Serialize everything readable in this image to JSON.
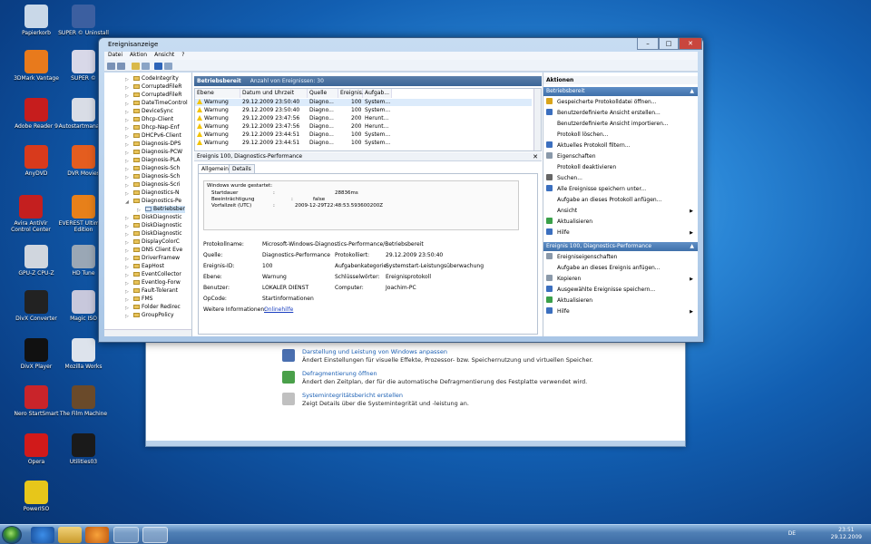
{
  "desktop": {
    "icons": [
      {
        "label": "Papierkorb",
        "color": "#c9d8e8"
      },
      {
        "label": "SUPER © Uninstall",
        "color": "#3c5fa0"
      },
      {
        "label": "3DMark Vantage",
        "color": "#e87a1c"
      },
      {
        "label": "SUPER ©",
        "color": "#d8d8e8"
      },
      {
        "label": "Adobe Reader 9",
        "color": "#c61d1d"
      },
      {
        "label": "Autostartmanager",
        "color": "#d9dde6"
      },
      {
        "label": "AnyDVD",
        "color": "#d83a1c"
      },
      {
        "label": "DVR Movies",
        "color": "#e45d1f"
      },
      {
        "label": "Avira AntiVir Control Center",
        "color": "#c41f1f"
      },
      {
        "label": "EVEREST Ultimate Edition",
        "color": "#e7801a"
      },
      {
        "label": "GPU-Z CPU-Z",
        "color": "#d0d6de"
      },
      {
        "label": "HD Tune",
        "color": "#9aa7b5"
      },
      {
        "label": "DivX Converter",
        "color": "#222"
      },
      {
        "label": "Magic ISO",
        "color": "#c8c8dc"
      },
      {
        "label": "DivX Player",
        "color": "#111"
      },
      {
        "label": "Mozilla Works",
        "color": "#dde3ec"
      },
      {
        "label": "Nero StartSmart",
        "color": "#c9242a"
      },
      {
        "label": "The Film Machine",
        "color": "#6a4a2a"
      },
      {
        "label": "Opera",
        "color": "#d11a1a"
      },
      {
        "label": "Utilities03",
        "color": "#1a1a1a"
      },
      {
        "label": "PowerISO",
        "color": "#e7c61a"
      }
    ]
  },
  "background_window": {
    "items": [
      {
        "link": "Darstellung und Leistung von Windows anpassen",
        "desc": "Ändert Einstellungen für visuelle Effekte, Prozessor- bzw. Speichernutzung und virtuellen Speicher.",
        "color": "#4a6fb0"
      },
      {
        "link": "Defragmentierung öffnen",
        "desc": "Ändert den Zeitplan, der für die automatische Defragmentierung des Festplatte verwendet wird.",
        "color": "#4aa04a"
      },
      {
        "link": "Systemintegritätsbericht erstellen",
        "desc": "Zeigt Details über die Systemintegrität und -leistung an.",
        "color": "#c0c0c0"
      }
    ]
  },
  "window": {
    "title": "Ereignisanzeige",
    "controls": {
      "min": "–",
      "max": "□",
      "close": "✕"
    },
    "menu": [
      "Datei",
      "Aktion",
      "Ansicht",
      "?"
    ],
    "tree": [
      {
        "label": "CodeIntegrity"
      },
      {
        "label": "CorruptedFileR"
      },
      {
        "label": "CorruptedFileR"
      },
      {
        "label": "DateTimeControl"
      },
      {
        "label": "DeviceSync"
      },
      {
        "label": "Dhcp-Client"
      },
      {
        "label": "Dhcp-Nap-Enf"
      },
      {
        "label": "DHCPv6-Client"
      },
      {
        "label": "Diagnosis-DPS"
      },
      {
        "label": "Diagnosis-PCW"
      },
      {
        "label": "Diagnosis-PLA"
      },
      {
        "label": "Diagnosis-Sch"
      },
      {
        "label": "Diagnosis-Sch"
      },
      {
        "label": "Diagnosis-Scri"
      },
      {
        "label": "Diagnostics-N"
      },
      {
        "label": "Diagnostics-Pe"
      },
      {
        "label": "Betriebsber"
      },
      {
        "label": "DiskDiagnostic"
      },
      {
        "label": "DiskDiagnostic"
      },
      {
        "label": "DiskDiagnostic"
      },
      {
        "label": "DisplayColorC"
      },
      {
        "label": "DNS Client Eve"
      },
      {
        "label": "DriverFramew"
      },
      {
        "label": "EapHost"
      },
      {
        "label": "EventCollector"
      },
      {
        "label": "Eventlog-Forw"
      },
      {
        "label": "Fault-Tolerant"
      },
      {
        "label": "FMS"
      },
      {
        "label": "Folder Redirec"
      },
      {
        "label": "GroupPolicy"
      }
    ],
    "center": {
      "title": "Betriebsbereit",
      "count": "Anzahl von Ereignissen: 30",
      "columns": [
        "Ebene",
        "Datum und Uhrzeit",
        "Quelle",
        "Ereignis...",
        "Aufgab..."
      ],
      "rows": [
        {
          "level": "Warnung",
          "date": "29.12.2009 23:50:40",
          "source": "Diagno...",
          "id": "100",
          "task": "System..."
        },
        {
          "level": "Warnung",
          "date": "29.12.2009 23:50:40",
          "source": "Diagno...",
          "id": "100",
          "task": "System..."
        },
        {
          "level": "Warnung",
          "date": "29.12.2009 23:47:56",
          "source": "Diagno...",
          "id": "200",
          "task": "Herunt..."
        },
        {
          "level": "Warnung",
          "date": "29.12.2009 23:47:56",
          "source": "Diagno...",
          "id": "200",
          "task": "Herunt..."
        },
        {
          "level": "Warnung",
          "date": "29.12.2009 23:44:51",
          "source": "Diagno...",
          "id": "100",
          "task": "System..."
        },
        {
          "level": "Warnung",
          "date": "29.12.2009 23:44:51",
          "source": "Diagno...",
          "id": "100",
          "task": "System..."
        }
      ],
      "detail_title": "Ereignis 100, Diagnostics-Performance",
      "tabs": [
        "Allgemein",
        "Details"
      ],
      "xml": {
        "heading": "Windows wurde gestartet:",
        "lines": [
          {
            "k": "Startdauer",
            "sep": ":",
            "v": "28836ms"
          },
          {
            "k": "Beeinträchtigung",
            "sep": ":",
            "v": "false"
          },
          {
            "k": "Vorfallzeit (UTC)",
            "sep": ":",
            "v": "2009-12-29T22:48:53.593600200Z"
          }
        ]
      },
      "props": {
        "protokollname_label": "Protokollname:",
        "protokollname": "Microsoft-Windows-Diagnostics-Performance/Betriebsbereit",
        "quelle_label": "Quelle:",
        "quelle": "Diagnostics-Performance",
        "protokolliert_label": "Protokolliert:",
        "protokolliert": "29.12.2009 23:50:40",
        "ereignisid_label": "Ereignis-ID:",
        "ereignisid": "100",
        "aufgabe_label": "Aufgabenkategorie:",
        "aufgabe": "Systemstart-Leistungsüberwachung",
        "ebene_label": "Ebene:",
        "ebene": "Warnung",
        "schluessel_label": "Schlüsselwörter:",
        "schluessel": "Ereignisprotokoll",
        "benutzer_label": "Benutzer:",
        "benutzer": "LOKALER DIENST",
        "computer_label": "Computer:",
        "computer": "Joachim-PC",
        "opcode_label": "OpCode:",
        "opcode": "Startinformationen",
        "info_label": "Weitere Informationen:",
        "info_link": "Onlinehilfe"
      }
    },
    "actions": {
      "header": "Aktionen",
      "section1": "Betriebsbereit",
      "items1": [
        {
          "label": "Gespeicherte Protokolldatei öffnen...",
          "color": "#d9a41a",
          "sub": ""
        },
        {
          "label": "Benutzerdefinierte Ansicht erstellen...",
          "color": "#3b6fbf",
          "sub": ""
        },
        {
          "label": "Benutzerdefinierte Ansicht importieren...",
          "color": "#ffffff",
          "sub": ""
        },
        {
          "label": "Protokoll löschen...",
          "color": "#ffffff",
          "sub": ""
        },
        {
          "label": "Aktuelles Protokoll filtern...",
          "color": "#3b6fbf",
          "sub": ""
        },
        {
          "label": "Eigenschaften",
          "color": "#8a99aa",
          "sub": ""
        },
        {
          "label": "Protokoll deaktivieren",
          "color": "#ffffff",
          "sub": ""
        },
        {
          "label": "Suchen...",
          "color": "#666666",
          "sub": ""
        },
        {
          "label": "Alle Ereignisse speichern unter...",
          "color": "#3b6fbf",
          "sub": ""
        },
        {
          "label": "Aufgabe an dieses Protokoll anfügen...",
          "color": "#ffffff",
          "sub": ""
        },
        {
          "label": "Ansicht",
          "color": "#ffffff",
          "sub": "▶"
        },
        {
          "label": "Aktualisieren",
          "color": "#3aa04a",
          "sub": ""
        },
        {
          "label": "Hilfe",
          "color": "#3b6fbf",
          "sub": "▶"
        }
      ],
      "section2": "Ereignis 100, Diagnostics-Performance",
      "items2": [
        {
          "label": "Ereigniseigenschaften",
          "color": "#8a99aa",
          "sub": ""
        },
        {
          "label": "Aufgabe an dieses Ereignis anfügen...",
          "color": "#ffffff",
          "sub": ""
        },
        {
          "label": "Kopieren",
          "color": "#8a99aa",
          "sub": "▶"
        },
        {
          "label": "Ausgewählte Ereignisse speichern...",
          "color": "#3b6fbf",
          "sub": ""
        },
        {
          "label": "Aktualisieren",
          "color": "#3aa04a",
          "sub": ""
        },
        {
          "label": "Hilfe",
          "color": "#3b6fbf",
          "sub": "▶"
        }
      ]
    }
  },
  "taskbar": {
    "lang": "DE",
    "time": "23:51",
    "date": "29.12.2009"
  }
}
